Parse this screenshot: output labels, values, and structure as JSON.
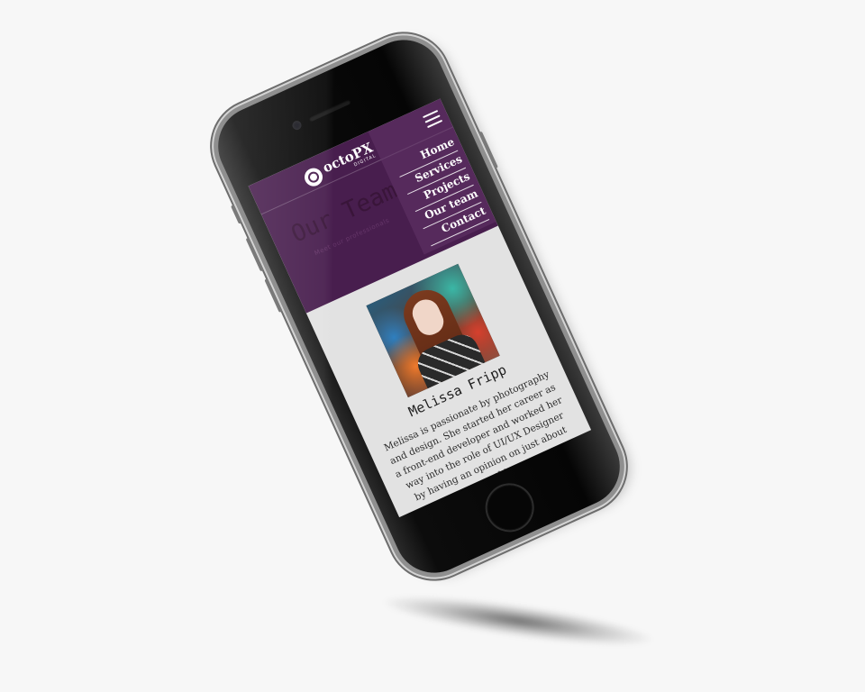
{
  "site": {
    "logo_text": "octoPX",
    "logo_sub": "DIGITAL",
    "logo_icon": "octopus-logo-icon"
  },
  "nav": {
    "menu_icon": "hamburger-icon",
    "items": [
      {
        "label": "Home"
      },
      {
        "label": "Services"
      },
      {
        "label": "Projects"
      },
      {
        "label": "Our team"
      },
      {
        "label": "Contact"
      }
    ]
  },
  "page": {
    "title": "Our Team",
    "subtitle": "Meet our professionals"
  },
  "member": {
    "name": "Melissa Fripp",
    "bio": "Melissa is passionate by photography and design. She started her career as a front-end developer and worked her way into the role of UI/UX Designer by having an opinion on just about everything."
  },
  "colors": {
    "brand_purple": "#481e4e",
    "screen_bg": "#e2e2e2",
    "page_bg": "#f7f7f7"
  }
}
